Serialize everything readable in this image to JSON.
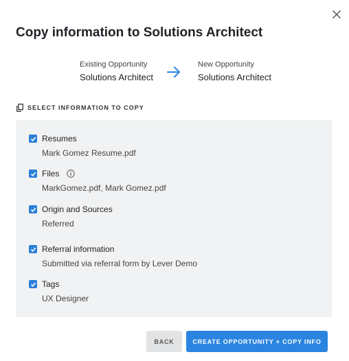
{
  "dialog": {
    "title": "Copy information to Solutions Architect"
  },
  "transfer": {
    "from_caption": "Existing Opportunity",
    "from_name": "Solutions Architect",
    "to_caption": "New Opportunity",
    "to_name": "Solutions Architect"
  },
  "section": {
    "heading": "SELECT INFORMATION TO COPY"
  },
  "items": [
    {
      "label": "Resumes",
      "value": "Mark Gomez Resume.pdf",
      "checked": true
    },
    {
      "label": "Files",
      "value": "MarkGomez.pdf, Mark Gomez.pdf",
      "checked": true
    },
    {
      "label": "Origin and Sources",
      "value": "Referred",
      "checked": true
    },
    {
      "label": "Referral information",
      "value": "Submitted via referral form by Lever Demo",
      "checked": true
    },
    {
      "label": "Tags",
      "value": "UX Designer",
      "checked": true
    }
  ],
  "buttons": {
    "back": "BACK",
    "create": "CREATE OPPORTUNITY + COPY INFO"
  },
  "colors": {
    "accent": "#2b84e0",
    "panel": "#f1f2f3"
  }
}
